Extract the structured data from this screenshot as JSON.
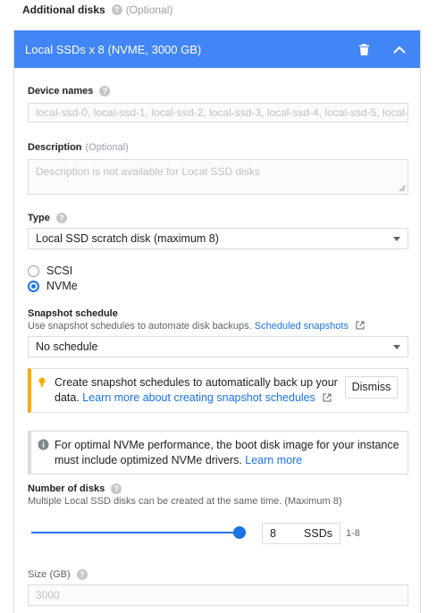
{
  "section": {
    "title": "Additional disks",
    "optional": "(Optional)"
  },
  "disk": {
    "header_title": "Local SSDs x 8 (NVME, 3000 GB)",
    "device_names_label": "Device names",
    "device_names_value": "local-ssd-0, local-ssd-1, local-ssd-2, local-ssd-3, local-ssd-4, local-ssd-5, local-",
    "description_label": "Description",
    "description_optional": "(Optional)",
    "description_placeholder": "Description is not available for Local SSD disks",
    "type_label": "Type",
    "type_value": "Local SSD scratch disk (maximum 8)",
    "interfaces": [
      {
        "label": "SCSI",
        "checked": false
      },
      {
        "label": "NVMe",
        "checked": true
      }
    ],
    "snapshot": {
      "label": "Snapshot schedule",
      "help_text": "Use snapshot schedules to automate disk backups.",
      "link": "Scheduled snapshots",
      "value": "No schedule"
    },
    "warn_callout": {
      "text_line1": "Create snapshot schedules to automatically back up your",
      "text_line2_prefix": "data.",
      "link": "Learn more about creating snapshot schedules",
      "dismiss": "Dismiss"
    },
    "info_callout": {
      "text_line1": "For optimal NVMe performance, the boot disk image for your instance",
      "text_line2_prefix": "must include optimized NVMe drivers.",
      "link": "Learn more"
    },
    "num_disks": {
      "label": "Number of disks",
      "help_text": "Multiple Local SSD disks can be created at the same time. (Maximum 8)",
      "value": "8",
      "unit": "SSDs",
      "range": "1-8",
      "slider_fraction": 1.0
    },
    "size": {
      "label": "Size (GB)",
      "value": "3000"
    }
  },
  "colors": {
    "accent": "#4285f4",
    "link": "#1a73e8",
    "warning": "#f9ab00"
  }
}
